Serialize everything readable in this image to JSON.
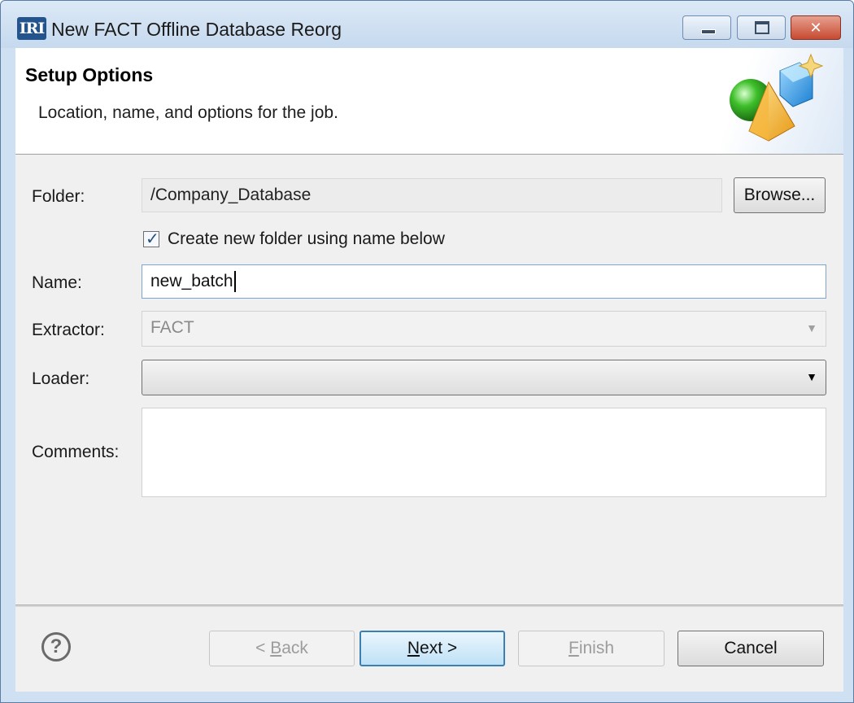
{
  "window": {
    "app_icon_text": "IRI",
    "title": "New FACT Offline Database Reorg"
  },
  "header": {
    "title": "Setup Options",
    "subtitle": "Location, name, and options for the job."
  },
  "form": {
    "folder": {
      "label": "Folder:",
      "value": "/Company_Database",
      "browse_label": "Browse..."
    },
    "create_folder": {
      "label": "Create new folder using name below",
      "checked": true
    },
    "name": {
      "label": "Name:",
      "value": "new_batch"
    },
    "extractor": {
      "label": "Extractor:",
      "value": "FACT"
    },
    "loader": {
      "label": "Loader:",
      "value": ""
    },
    "comments": {
      "label": "Comments:",
      "value": ""
    }
  },
  "footer": {
    "back": {
      "prefix": "< ",
      "mnemonic": "B",
      "rest": "ack"
    },
    "next": {
      "mnemonic": "N",
      "rest": "ext >"
    },
    "finish": {
      "mnemonic": "F",
      "rest": "inish"
    },
    "cancel": {
      "label": "Cancel"
    }
  },
  "colors": {
    "titlebar": "#c6d9ee",
    "accent_default_button": "#3c7fb1",
    "close_button": "#c64a31"
  },
  "icons": [
    "iri-app-icon",
    "minimize-icon",
    "maximize-icon",
    "close-icon",
    "wizard-shapes-icon",
    "help-icon",
    "checkbox-checked-icon",
    "dropdown-arrow-icon"
  ]
}
